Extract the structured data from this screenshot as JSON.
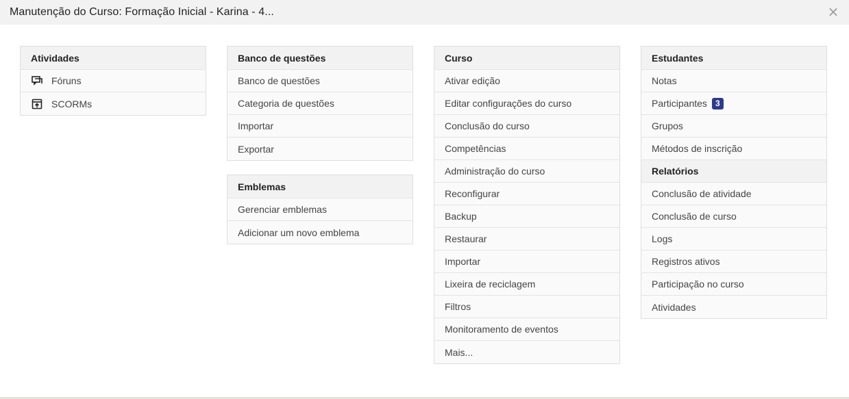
{
  "modal": {
    "title": "Manutenção do Curso: Formação Inicial - Karina - 4...",
    "close_label": "×"
  },
  "atividades": {
    "header": "Atividades",
    "items": [
      {
        "label": "Fóruns",
        "icon": "forum-icon"
      },
      {
        "label": "SCORMs",
        "icon": "scorm-package-icon"
      }
    ]
  },
  "banco": {
    "header": "Banco de questões",
    "items": [
      "Banco de questões",
      "Categoria de questões",
      "Importar",
      "Exportar"
    ]
  },
  "emblemas": {
    "header": "Emblemas",
    "items": [
      "Gerenciar emblemas",
      "Adicionar um novo emblema"
    ]
  },
  "curso": {
    "header": "Curso",
    "items": [
      "Ativar edição",
      "Editar configurações do curso",
      "Conclusão do curso",
      "Competências",
      "Administração do curso",
      "Reconfigurar",
      "Backup",
      "Restaurar",
      "Importar",
      "Lixeira de reciclagem",
      "Filtros",
      "Monitoramento de eventos",
      "Mais..."
    ]
  },
  "estudantes": {
    "header": "Estudantes",
    "items": [
      "Notas",
      "Participantes",
      "Grupos",
      "Métodos de inscrição"
    ],
    "participants_badge": "3"
  },
  "relatorios": {
    "header": "Relatórios",
    "items": [
      "Conclusão de atividade",
      "Conclusão de curso",
      "Logs",
      "Registros ativos",
      "Participação no curso",
      "Atividades"
    ]
  },
  "colors": {
    "badge": "#2e3b8a",
    "header_bg": "#f2f2f2",
    "item_bg": "#fafafa"
  }
}
